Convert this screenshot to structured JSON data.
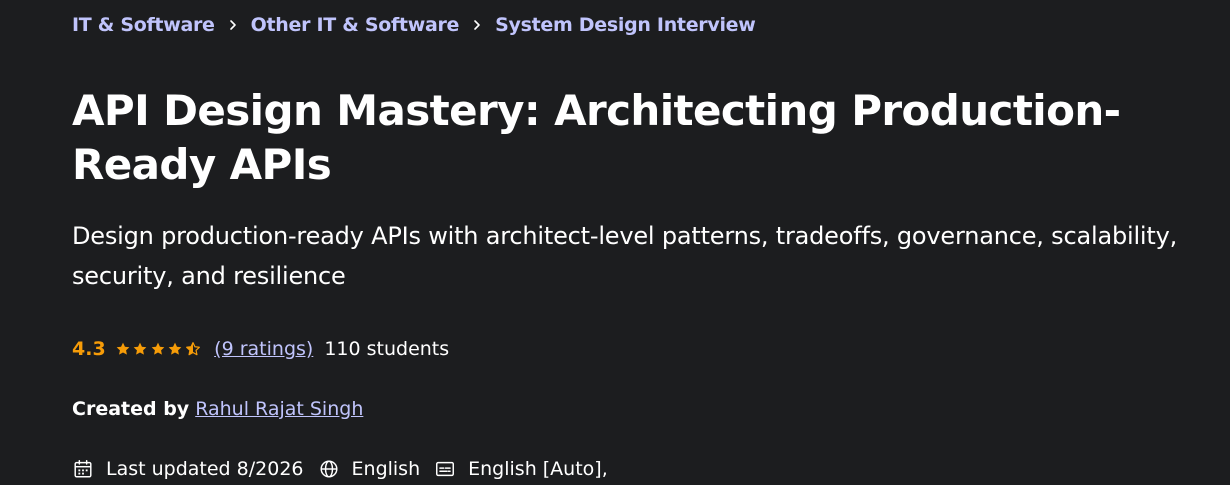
{
  "breadcrumb": [
    {
      "label": "IT & Software"
    },
    {
      "label": "Other IT & Software"
    },
    {
      "label": "System Design Interview"
    }
  ],
  "course": {
    "title": "API Design Mastery: Architecting Production-Ready APIs",
    "subtitle": "Design production-ready APIs with architect-level patterns, tradeoffs, governance, scalability, security, and resilience"
  },
  "rating": {
    "value": "4.3",
    "stars": 4.3,
    "ratings_text": "(9 ratings)",
    "students_text": "110 students"
  },
  "creator": {
    "label": "Created by",
    "name": "Rahul Rajat Singh"
  },
  "meta": {
    "last_updated": "Last updated 8/2026",
    "language": "English",
    "captions": "English [Auto],"
  },
  "colors": {
    "background": "#1c1d1f",
    "link": "#c0c4fc",
    "rating": "#f69c08",
    "text": "#ffffff"
  },
  "icons": {
    "separator": "chevron-right-icon",
    "star_full": "star-icon",
    "star_half": "star-half-icon",
    "calendar": "calendar-icon",
    "globe": "globe-icon",
    "captions": "closed-captions-icon"
  }
}
